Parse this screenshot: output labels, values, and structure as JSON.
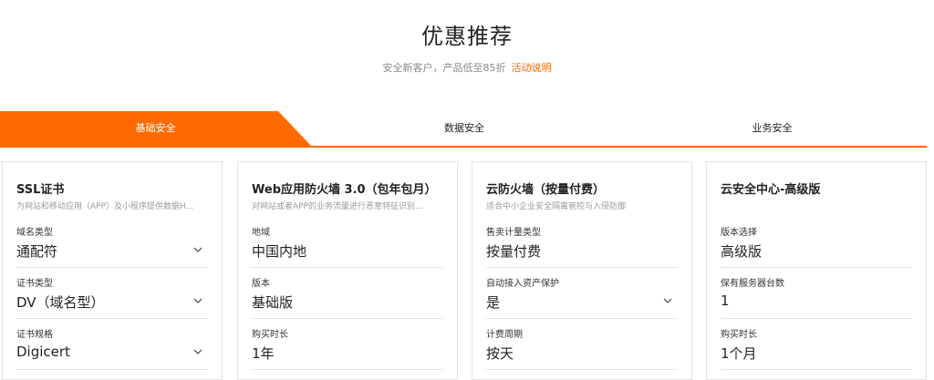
{
  "hero": {
    "title": "优惠推荐",
    "subtitle": "安全新客户，产品低至85折",
    "promo_link": "活动说明"
  },
  "colors": {
    "accent": "#ff6a00"
  },
  "tabs": [
    {
      "label": "基础安全",
      "active": true
    },
    {
      "label": "数据安全",
      "active": false
    },
    {
      "label": "业务安全",
      "active": false
    }
  ],
  "cards": [
    {
      "title": "SSL证书",
      "desc": "为网站和移动应用（APP）及小程序提供数据H...",
      "fields": [
        {
          "label": "域名类型",
          "value": "通配符",
          "dropdown": true
        },
        {
          "label": "证书类型",
          "value": "DV（域名型）",
          "dropdown": true
        },
        {
          "label": "证书规格",
          "value": "Digicert",
          "dropdown": true
        }
      ]
    },
    {
      "title": "Web应用防火墙 3.0（包年包月）",
      "desc": "对网站或者APP的业务流量进行恶意特征识别...",
      "fields": [
        {
          "label": "地域",
          "value": "中国内地",
          "dropdown": false
        },
        {
          "label": "版本",
          "value": "基础版",
          "dropdown": false
        },
        {
          "label": "购买时长",
          "value": "1年",
          "dropdown": false
        }
      ]
    },
    {
      "title": "云防火墙（按量付费）",
      "desc": "适合中小企业安全隔离管控与入侵防御",
      "fields": [
        {
          "label": "售卖计量类型",
          "value": "按量付费",
          "dropdown": false
        },
        {
          "label": "自动接入资产保护",
          "value": "是",
          "dropdown": true
        },
        {
          "label": "计费周期",
          "value": "按天",
          "dropdown": false
        }
      ]
    },
    {
      "title": "云安全中心-高级版",
      "desc": "",
      "fields": [
        {
          "label": "版本选择",
          "value": "高级版",
          "dropdown": false
        },
        {
          "label": "保有服务器台数",
          "value": "1",
          "dropdown": false
        },
        {
          "label": "购买时长",
          "value": "1个月",
          "dropdown": false
        }
      ]
    }
  ],
  "icons": {
    "dropdown": "chevron-down-icon"
  }
}
